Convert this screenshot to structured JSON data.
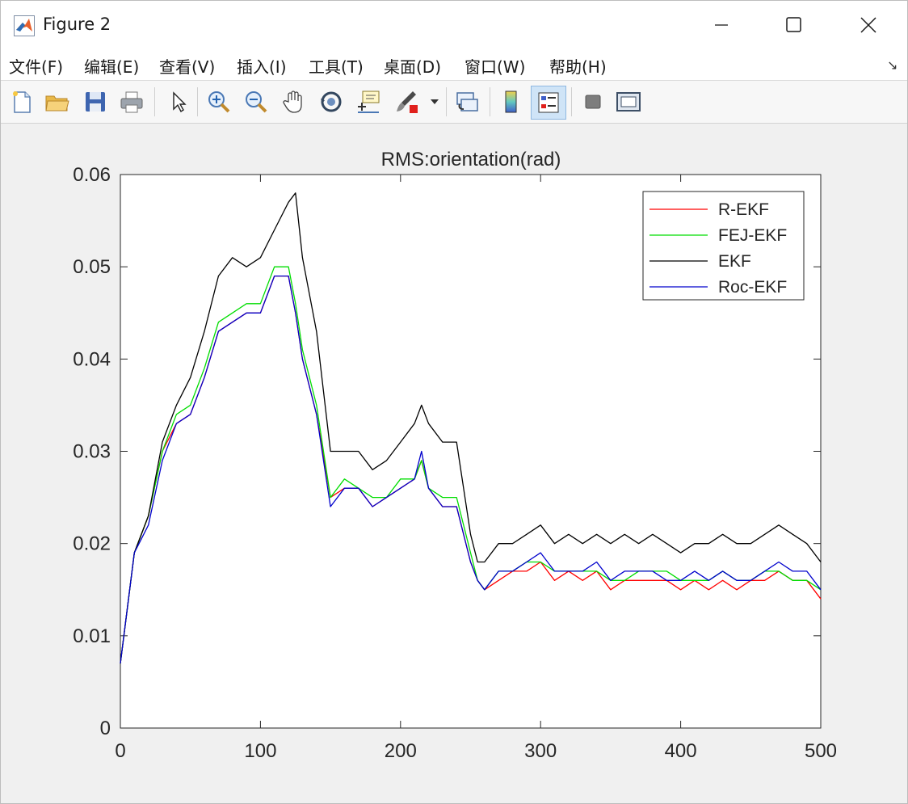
{
  "window": {
    "title": "Figure 2",
    "controls": {
      "minimize": "minimize",
      "maximize": "maximize",
      "close": "close"
    }
  },
  "menu": {
    "items": [
      {
        "label": "文件(F)"
      },
      {
        "label": "编辑(E)"
      },
      {
        "label": "查看(V)"
      },
      {
        "label": "插入(I)"
      },
      {
        "label": "工具(T)"
      },
      {
        "label": "桌面(D)"
      },
      {
        "label": "窗口(W)"
      },
      {
        "label": "帮助(H)"
      }
    ],
    "dock_arrow": "↘"
  },
  "toolbar": {
    "buttons": [
      "new-figure-icon",
      "open-file-icon",
      "save-icon",
      "print-icon",
      "pointer-arrow-icon",
      "zoom-in-icon",
      "zoom-out-icon",
      "pan-hand-icon",
      "rotate-3d-icon",
      "data-cursor-icon",
      "brush-icon",
      "link-plot-icon",
      "colorbar-icon",
      "legend-icon",
      "hide-plot-tools-icon",
      "show-plot-tools-icon"
    ]
  },
  "chart_data": {
    "type": "line",
    "title": "RMS:orientation(rad)",
    "xlabel": "",
    "ylabel": "",
    "xlim": [
      0,
      500
    ],
    "ylim": [
      0,
      0.06
    ],
    "x_ticks": [
      "0",
      "100",
      "200",
      "300",
      "400",
      "500"
    ],
    "y_ticks": [
      "0",
      "0.01",
      "0.02",
      "0.03",
      "0.04",
      "0.05",
      "0.06"
    ],
    "grid": false,
    "legend_position": "top-right",
    "x": [
      0,
      10,
      20,
      30,
      40,
      50,
      60,
      70,
      80,
      90,
      100,
      110,
      120,
      125,
      130,
      140,
      150,
      160,
      170,
      180,
      190,
      200,
      210,
      215,
      220,
      230,
      240,
      250,
      255,
      260,
      270,
      280,
      290,
      300,
      310,
      320,
      330,
      340,
      350,
      360,
      370,
      380,
      390,
      400,
      410,
      420,
      430,
      440,
      450,
      460,
      470,
      480,
      490,
      500
    ],
    "series": [
      {
        "name": "R-EKF",
        "color": "#ff0000",
        "values": [
          0.007,
          0.019,
          0.023,
          0.03,
          0.033,
          0.034,
          0.038,
          0.043,
          0.044,
          0.045,
          0.045,
          0.049,
          0.049,
          0.045,
          0.04,
          0.034,
          0.025,
          0.026,
          0.026,
          0.024,
          0.025,
          0.026,
          0.027,
          0.029,
          0.026,
          0.024,
          0.024,
          0.018,
          0.016,
          0.015,
          0.016,
          0.017,
          0.017,
          0.018,
          0.016,
          0.017,
          0.016,
          0.017,
          0.015,
          0.016,
          0.016,
          0.016,
          0.016,
          0.015,
          0.016,
          0.015,
          0.016,
          0.015,
          0.016,
          0.016,
          0.017,
          0.016,
          0.016,
          0.014
        ]
      },
      {
        "name": "FEJ-EKF",
        "color": "#00dd00",
        "values": [
          0.007,
          0.019,
          0.023,
          0.03,
          0.034,
          0.035,
          0.039,
          0.044,
          0.045,
          0.046,
          0.046,
          0.05,
          0.05,
          0.046,
          0.041,
          0.035,
          0.025,
          0.027,
          0.026,
          0.025,
          0.025,
          0.027,
          0.027,
          0.029,
          0.026,
          0.025,
          0.025,
          0.019,
          0.016,
          0.015,
          0.017,
          0.017,
          0.018,
          0.018,
          0.017,
          0.017,
          0.017,
          0.017,
          0.016,
          0.016,
          0.017,
          0.017,
          0.017,
          0.016,
          0.016,
          0.016,
          0.017,
          0.016,
          0.016,
          0.017,
          0.017,
          0.016,
          0.016,
          0.015
        ]
      },
      {
        "name": "EKF",
        "color": "#000000",
        "values": [
          0.007,
          0.019,
          0.023,
          0.031,
          0.035,
          0.038,
          0.043,
          0.049,
          0.051,
          0.05,
          0.051,
          0.054,
          0.057,
          0.058,
          0.051,
          0.043,
          0.03,
          0.03,
          0.03,
          0.028,
          0.029,
          0.031,
          0.033,
          0.035,
          0.033,
          0.031,
          0.031,
          0.021,
          0.018,
          0.018,
          0.02,
          0.02,
          0.021,
          0.022,
          0.02,
          0.021,
          0.02,
          0.021,
          0.02,
          0.021,
          0.02,
          0.021,
          0.02,
          0.019,
          0.02,
          0.02,
          0.021,
          0.02,
          0.02,
          0.021,
          0.022,
          0.021,
          0.02,
          0.018
        ]
      },
      {
        "name": "Roc-EKF",
        "color": "#0000cc",
        "values": [
          0.007,
          0.019,
          0.022,
          0.029,
          0.033,
          0.034,
          0.038,
          0.043,
          0.044,
          0.045,
          0.045,
          0.049,
          0.049,
          0.045,
          0.04,
          0.034,
          0.024,
          0.026,
          0.026,
          0.024,
          0.025,
          0.026,
          0.027,
          0.03,
          0.026,
          0.024,
          0.024,
          0.018,
          0.016,
          0.015,
          0.017,
          0.017,
          0.018,
          0.019,
          0.017,
          0.017,
          0.017,
          0.018,
          0.016,
          0.017,
          0.017,
          0.017,
          0.016,
          0.016,
          0.017,
          0.016,
          0.017,
          0.016,
          0.016,
          0.017,
          0.018,
          0.017,
          0.017,
          0.015
        ]
      }
    ]
  }
}
